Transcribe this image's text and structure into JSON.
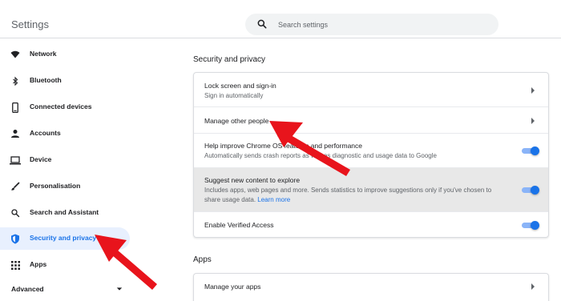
{
  "header": {
    "title": "Settings",
    "search_placeholder": "Search settings"
  },
  "sidebar": {
    "items": [
      {
        "label": "Network",
        "icon": "wifi-icon"
      },
      {
        "label": "Bluetooth",
        "icon": "bluetooth-icon"
      },
      {
        "label": "Connected devices",
        "icon": "phone-icon"
      },
      {
        "label": "Accounts",
        "icon": "person-icon"
      },
      {
        "label": "Device",
        "icon": "laptop-icon"
      },
      {
        "label": "Personalisation",
        "icon": "brush-icon"
      },
      {
        "label": "Search and Assistant",
        "icon": "search-icon"
      },
      {
        "label": "Security and privacy",
        "icon": "shield-icon",
        "active": true
      },
      {
        "label": "Apps",
        "icon": "grid-icon"
      }
    ],
    "advanced_label": "Advanced"
  },
  "main": {
    "security_title": "Security and privacy",
    "security_rows": [
      {
        "title": "Lock screen and sign-in",
        "subtitle": "Sign in automatically",
        "control": "arrow"
      },
      {
        "title": "Manage other people",
        "control": "arrow"
      },
      {
        "title": "Help improve Chrome OS features and performance",
        "subtitle": "Automatically sends crash reports as well as diagnostic and usage data to Google",
        "control": "toggle",
        "on": true
      },
      {
        "title": "Suggest new content to explore",
        "subtitle": "Includes apps, web pages and more. Sends statistics to improve suggestions only if you've chosen to",
        "subtitle2": "share usage data.",
        "link": "Learn more",
        "control": "toggle",
        "on": true,
        "highlighted": true
      },
      {
        "title": "Enable Verified Access",
        "control": "toggle",
        "on": true
      }
    ],
    "apps_title": "Apps",
    "apps_rows": [
      {
        "title": "Manage your apps",
        "control": "arrow"
      }
    ]
  },
  "colors": {
    "accent": "#1a73e8",
    "active_bg": "#e8f0fe",
    "annotation_arrow": "#e8141c",
    "highlight_row": "#e8e8e8"
  }
}
